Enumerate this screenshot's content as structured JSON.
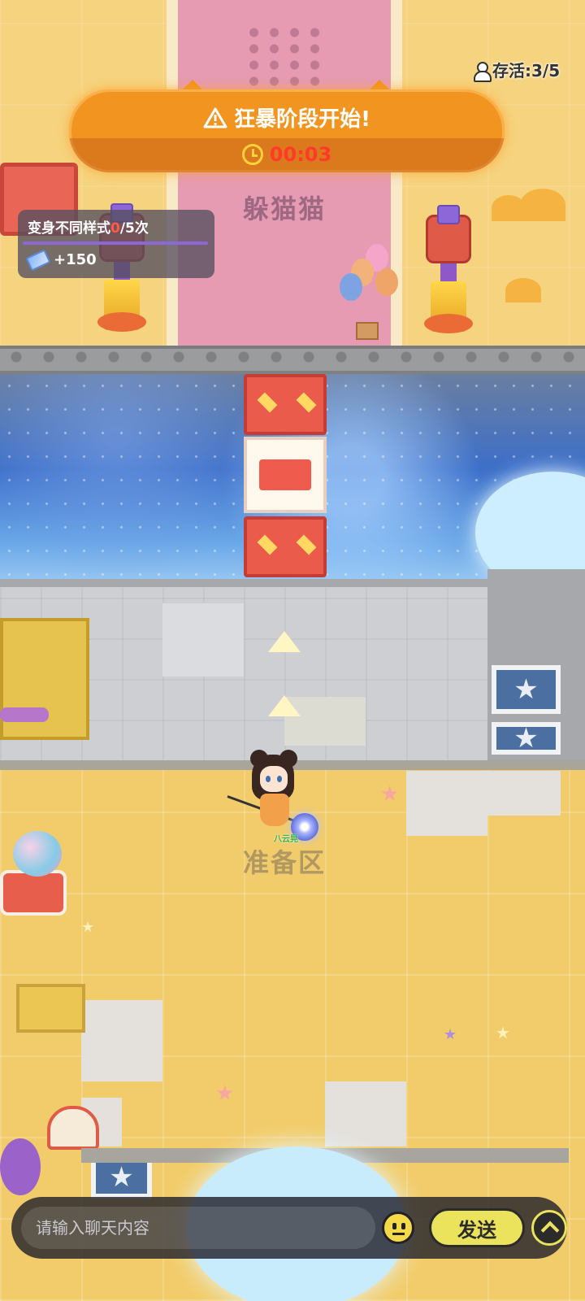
{
  "hud": {
    "survivors_text": "存活:3/5",
    "survivors_icon": "person-icon"
  },
  "banner": {
    "title": "狂暴阶段开始!",
    "title_icon": "warning-icon",
    "timer": "00:03",
    "timer_icon": "clock-icon"
  },
  "task": {
    "label": "变身不同样式",
    "current": "0",
    "total_suffix": "/5次",
    "reward_icon": "ticket-icon",
    "reward": "+150"
  },
  "map": {
    "top_zone_label": "躲猫猫",
    "ready_zone_label": "准备区",
    "player_name": "八云晃"
  },
  "chat": {
    "placeholder": "请输入聊天内容",
    "emoji_icon": "emoji-icon",
    "send_label": "发送",
    "expand_icon": "chevron-up-icon"
  },
  "colors": {
    "banner": "#f29420",
    "timer": "#ff3a2a",
    "task_count": "#ff5a48",
    "send_button": "#ece35c"
  }
}
